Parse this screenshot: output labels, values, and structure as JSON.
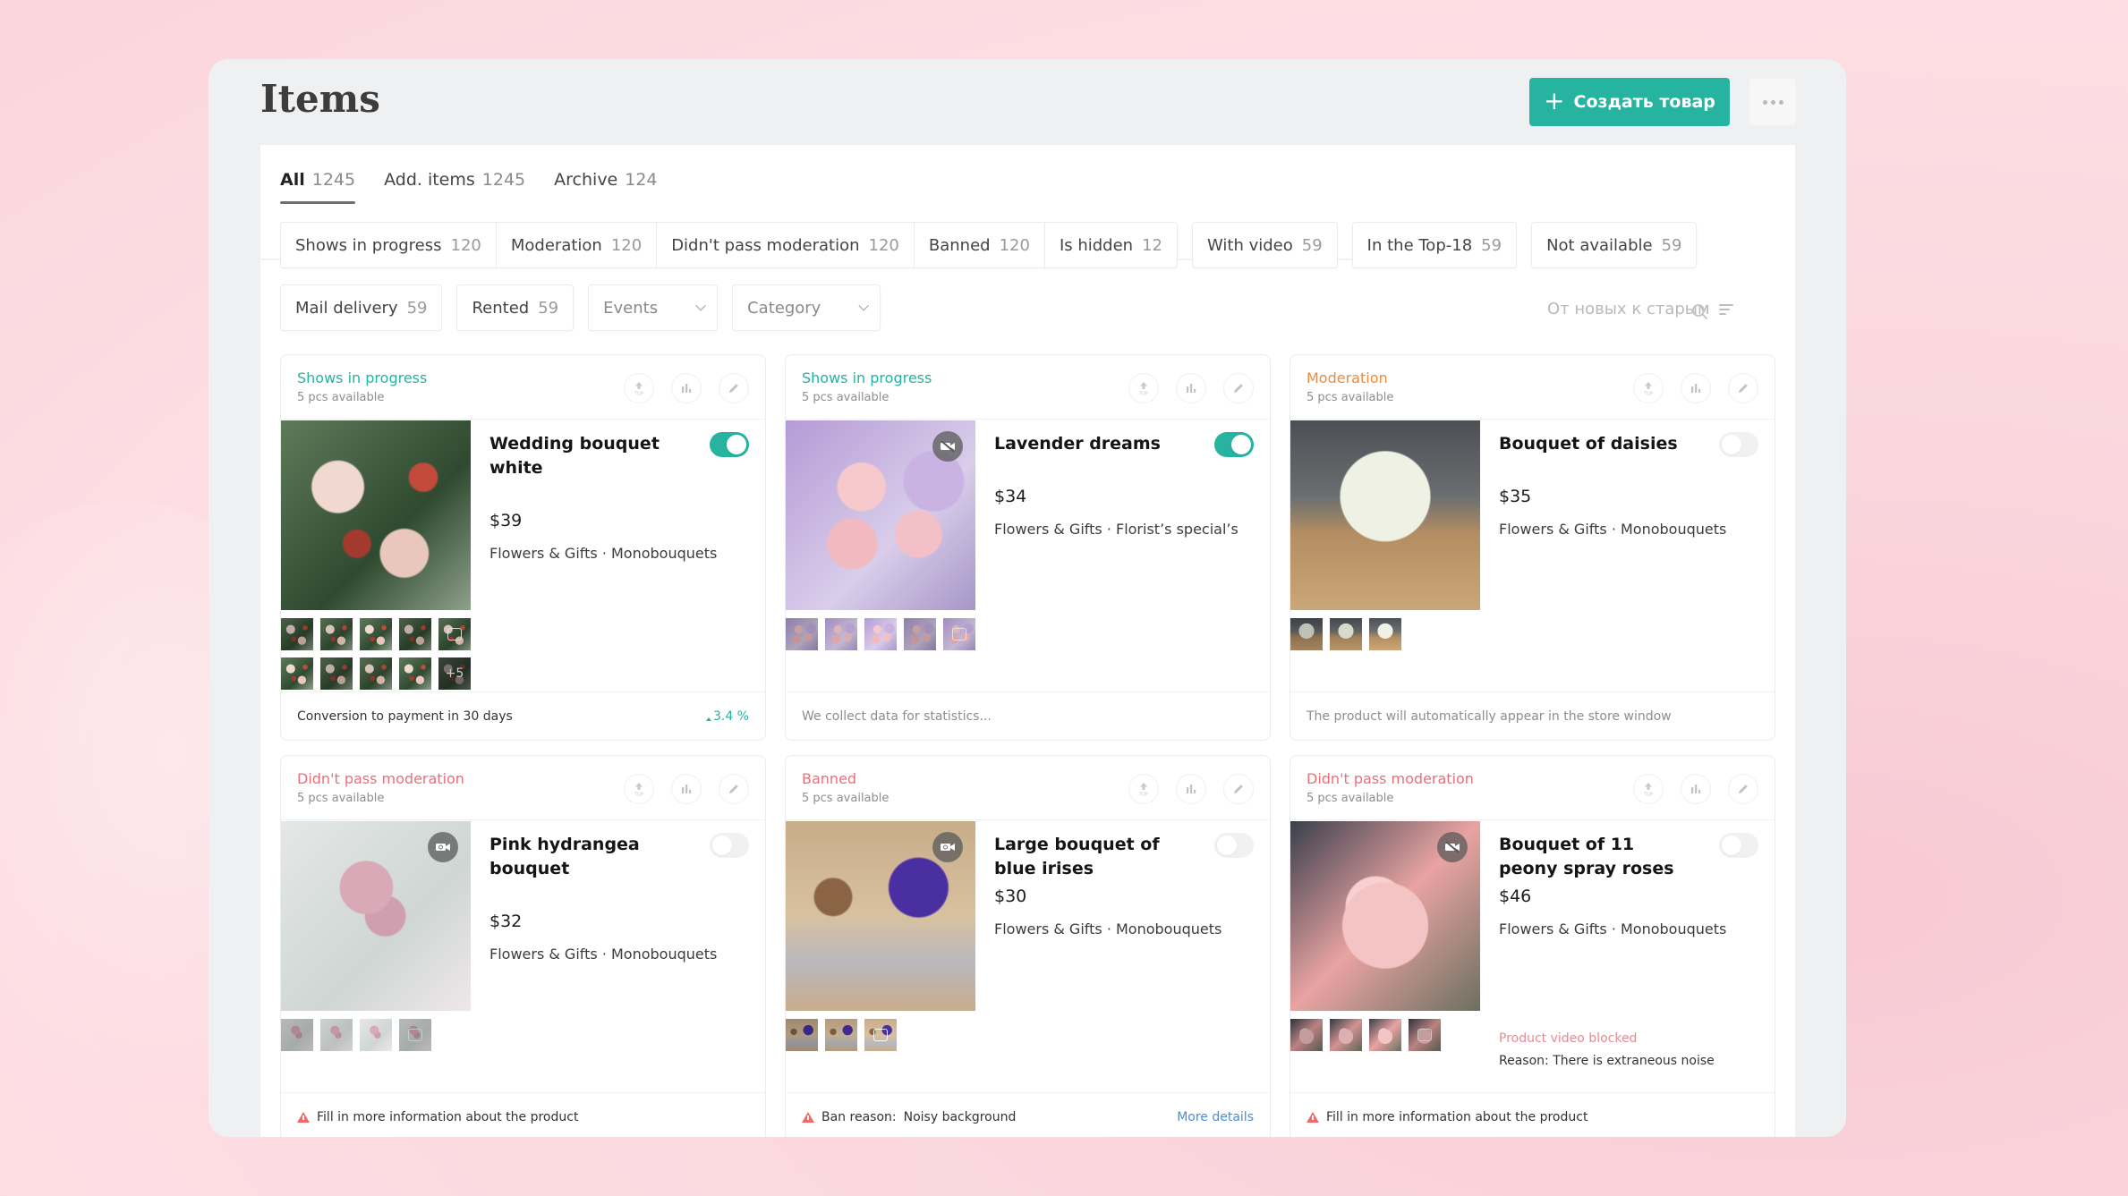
{
  "colors": {
    "accent": "#26b3a0",
    "status_progress": "#26b3a0",
    "status_moderation": "#ef8a3a",
    "status_error": "#ea6f78",
    "link": "#4a8fd8",
    "warning": "#ef6b6b"
  },
  "header": {
    "title": "Items",
    "create_button": {
      "icon": "plus-icon",
      "label": "Создать товар"
    },
    "more_button": {
      "icon": "more-dots-icon"
    }
  },
  "tabs": [
    {
      "label": "All",
      "count": "1245",
      "active": true
    },
    {
      "label": "Add. items",
      "count": "1245",
      "active": false
    },
    {
      "label": "Archive",
      "count": "124",
      "active": false
    }
  ],
  "filters": {
    "row1": [
      {
        "label": "Shows in progress",
        "count": "120"
      },
      {
        "label": "Moderation",
        "count": "120"
      },
      {
        "label": "Didn't pass moderation",
        "count": "120"
      },
      {
        "label": "Banned",
        "count": "120"
      },
      {
        "label": "Is hidden",
        "count": "12"
      },
      {
        "label": "With video",
        "count": "59"
      },
      {
        "label": "In the Top-18",
        "count": "59"
      },
      {
        "label": "Not available",
        "count": "59"
      }
    ],
    "row2": [
      {
        "label": "Mail delivery",
        "count": "59"
      },
      {
        "label": "Rented",
        "count": "59"
      }
    ],
    "selects": [
      {
        "label": "Events",
        "icon": "chevron-down-icon"
      },
      {
        "label": "Category",
        "icon": "chevron-down-icon"
      }
    ]
  },
  "sort": {
    "label": "От новых к старым",
    "icon": "sort-icon"
  },
  "search": {
    "icon": "search-icon"
  },
  "card_actions": {
    "top_label": "TOP",
    "icons": [
      "top-promote-icon",
      "stats-chart-icon",
      "edit-pencil-icon"
    ]
  },
  "cards": [
    {
      "status": "Shows in progress",
      "status_kind": "progress",
      "availability": "5 pcs available",
      "title": "Wedding bouquet white",
      "price": "$39",
      "category": "Flowers & Gifts · Monobouquets",
      "enabled": true,
      "video_badge": null,
      "thumbnails": 10,
      "more_photos": "+5",
      "footer": {
        "type": "conversion",
        "text": "Conversion to payment in 30 days",
        "value": "3.4 %",
        "trend": "up"
      }
    },
    {
      "status": "Shows in progress",
      "status_kind": "progress",
      "availability": "5 pcs available",
      "title": "Lavender dreams",
      "price": "$34",
      "category": "Flowers & Gifts · Florist’s special’s",
      "enabled": true,
      "video_badge": "video-off-icon",
      "thumbnails": 5,
      "footer": {
        "type": "muted",
        "text": "We collect data for statistics..."
      }
    },
    {
      "status": "Moderation",
      "status_kind": "moderation",
      "availability": "5 pcs available",
      "title": "Bouquet of daisies",
      "price": "$35",
      "category": "Flowers & Gifts · Monobouquets",
      "enabled": false,
      "video_badge": null,
      "thumbnails": 3,
      "footer": {
        "type": "muted",
        "text": "The product will automatically appear in the store window"
      }
    },
    {
      "status": "Didn't pass moderation",
      "status_kind": "error",
      "availability": "5 pcs available",
      "title": "Pink hydrangea bouquet",
      "price": "$32",
      "category": "Flowers & Gifts · Monobouquets",
      "enabled": false,
      "video_badge": "video-camera-icon",
      "thumbnails": 4,
      "footer": {
        "type": "warning",
        "text": "Fill in more information about the product"
      }
    },
    {
      "status": "Banned",
      "status_kind": "error",
      "availability": "5 pcs available",
      "title": "Large bouquet of blue irises",
      "price": "$30",
      "category": "Flowers & Gifts · Monobouquets",
      "enabled": false,
      "video_badge": "video-camera-icon",
      "thumbnails": 3,
      "footer": {
        "type": "ban",
        "label": "Ban reason:",
        "value": "Noisy background",
        "link": "More details"
      }
    },
    {
      "status": "Didn't pass moderation",
      "status_kind": "error",
      "availability": "5 pcs available",
      "title": "Bouquet of 11 peony spray roses",
      "price": "$46",
      "category": "Flowers & Gifts · Monobouquets",
      "enabled": false,
      "video_badge": "video-off-icon",
      "thumbnails": 4,
      "video_note": {
        "heading": "Product video blocked",
        "reason": "Reason: There is extraneous noise"
      },
      "footer": {
        "type": "warning",
        "text": "Fill in more information about the product"
      }
    }
  ]
}
